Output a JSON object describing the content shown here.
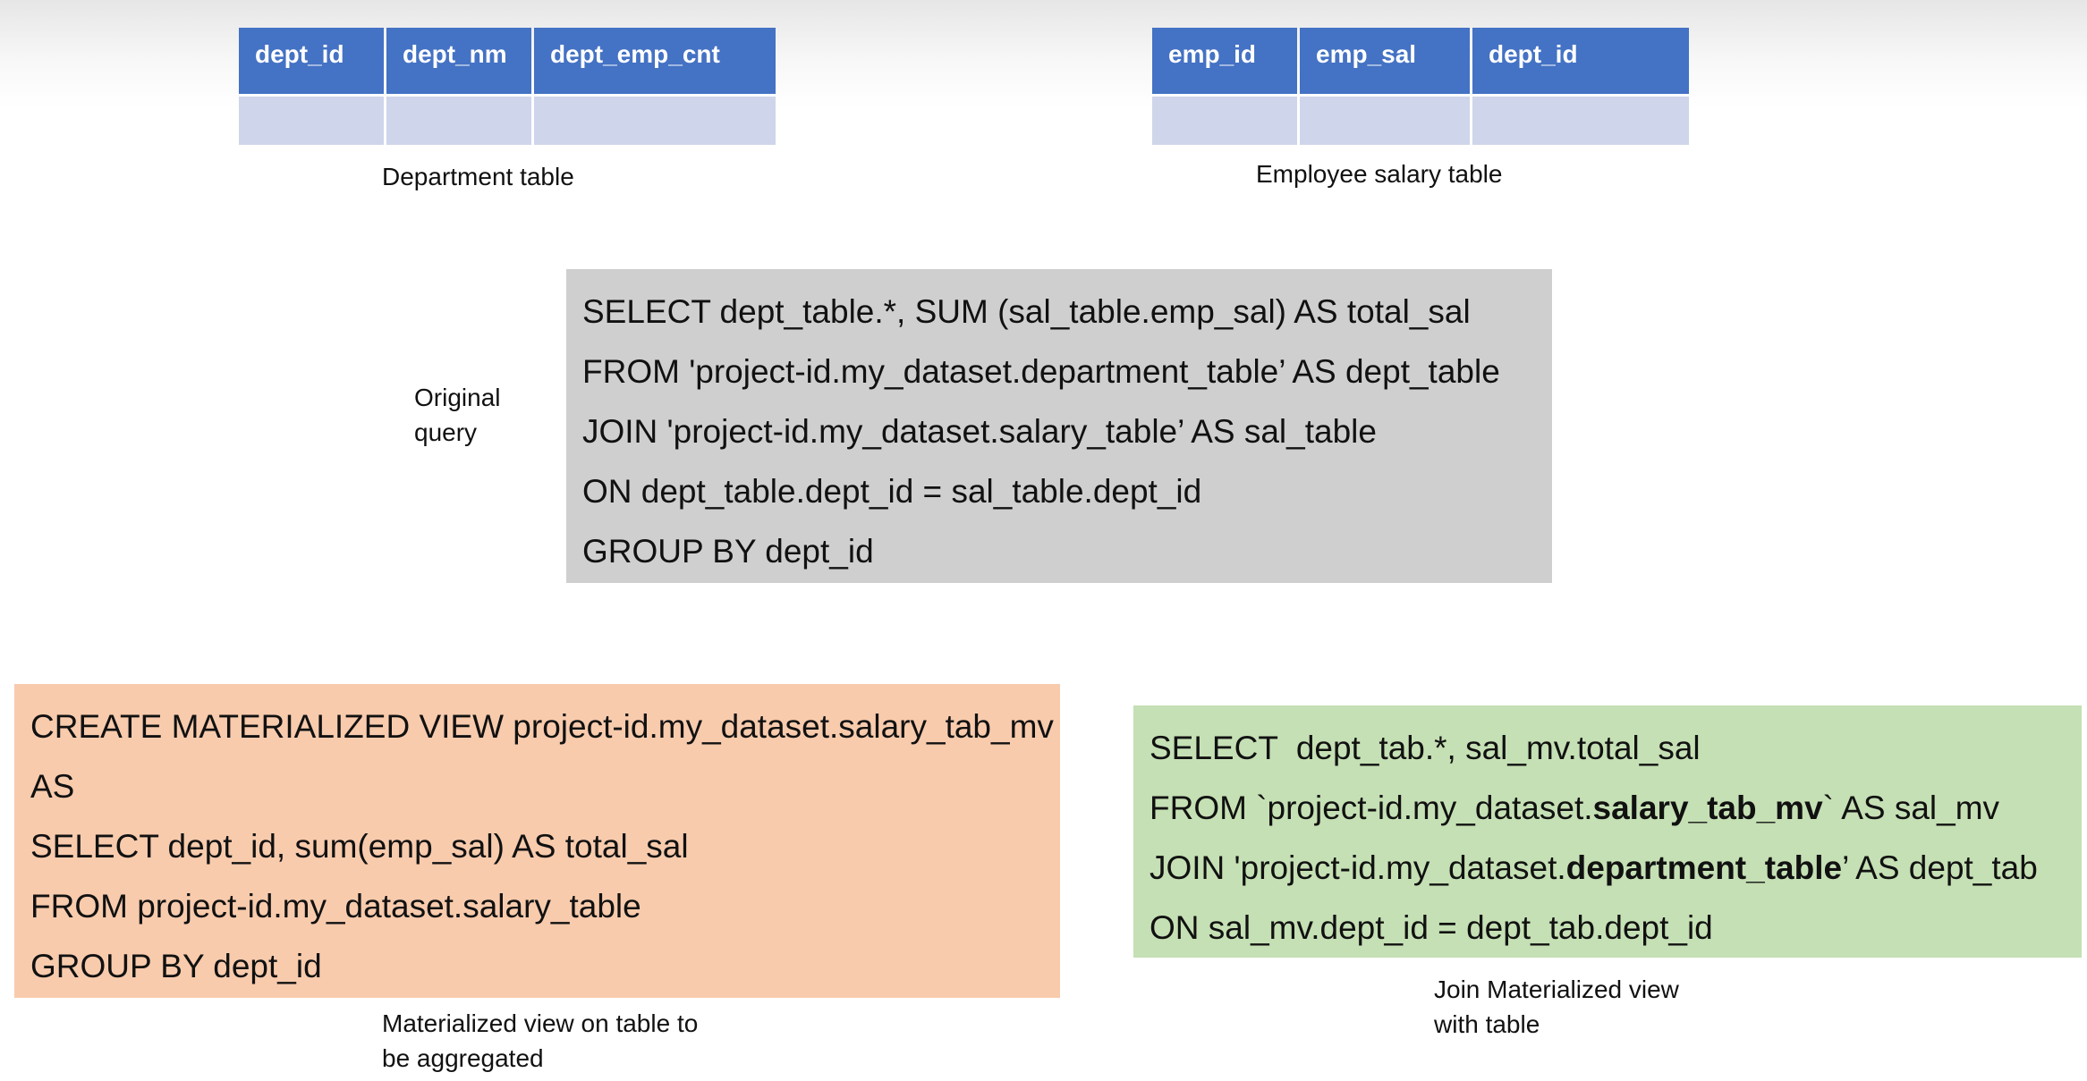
{
  "department_table": {
    "columns": [
      "dept_id",
      "dept_nm",
      "dept_emp_cnt"
    ],
    "caption": "Department table"
  },
  "salary_table": {
    "columns": [
      "emp_id",
      "emp_sal",
      "dept_id"
    ],
    "caption": "Employee salary table"
  },
  "original_query": {
    "label_line1": "Original",
    "label_line2": "query",
    "lines": [
      "SELECT dept_table.*, SUM (sal_table.emp_sal) AS total_sal",
      "FROM 'project-id.my_dataset.department_table’ AS dept_table",
      "JOIN 'project-id.my_dataset.salary_table’ AS sal_table",
      "ON dept_table.dept_id = sal_table.dept_id",
      "GROUP BY dept_id"
    ]
  },
  "materialized_view": {
    "lines": [
      "CREATE MATERIALIZED VIEW project-id.my_dataset.salary_tab_mv",
      "AS",
      "SELECT dept_id, sum(emp_sal) AS total_sal",
      "FROM project-id.my_dataset.salary_table",
      "GROUP BY dept_id"
    ],
    "caption_line1": "Materialized view on table to",
    "caption_line2": "be aggregated"
  },
  "join_query": {
    "line1": "SELECT  dept_tab.*, sal_mv.total_sal",
    "line2_prefix": "FROM `project-id.my_dataset.",
    "line2_bold": "salary_tab_mv",
    "line2_suffix": "` AS sal_mv",
    "line3_prefix": "JOIN 'project-id.my_dataset.",
    "line3_bold": "department_table",
    "line3_suffix": "’ AS dept_tab",
    "line4": "ON sal_mv.dept_id = dept_tab.dept_id",
    "caption_line1": "Join Materialized view",
    "caption_line2": "with table"
  },
  "colors": {
    "header_blue": "#4472c4",
    "row_lavender": "#cfd5ea",
    "gray_box": "#d0cfcf",
    "orange_box": "#f8cbad",
    "green_box": "#c5e0b4"
  }
}
